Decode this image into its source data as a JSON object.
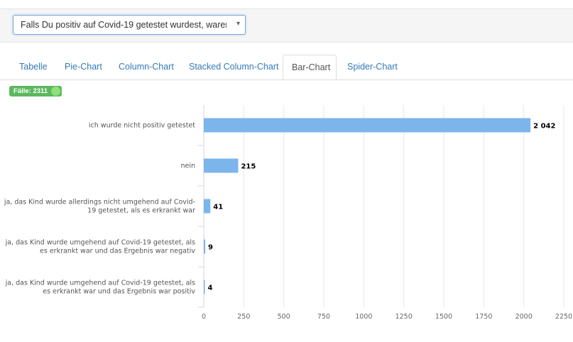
{
  "question_select": {
    "value": "Falls Du positiv auf Covid-19 getestet wurdest, waren…"
  },
  "tabs": [
    {
      "label": "Tabelle"
    },
    {
      "label": "Pie-Chart"
    },
    {
      "label": "Column-Chart"
    },
    {
      "label": "Stacked Column-Chart"
    },
    {
      "label": "Bar-Chart"
    },
    {
      "label": "Spider-Chart"
    }
  ],
  "active_tab": "Bar-Chart",
  "cases_badge": {
    "label": "Fälle: 2311"
  },
  "colors": {
    "bar": "#7cb5ec",
    "badge": "#5cb85c",
    "link": "#337ab7"
  },
  "chart_data": {
    "type": "bar",
    "orientation": "horizontal",
    "categories": [
      [
        "ich wurde nicht positiv getestet"
      ],
      [
        "nein"
      ],
      [
        "ja, das Kind wurde allerdings nicht umgehend auf Covid-",
        "19 getestet, als es erkrankt war"
      ],
      [
        "ja, das Kind wurde umgehend auf Covid-19 getestet, als",
        "es erkrankt war und das Ergebnis war negativ"
      ],
      [
        "ja, das Kind wurde umgehend auf Covid-19 getestet, als",
        "es erkrankt war und das Ergebnis war positiv"
      ]
    ],
    "values": [
      2042,
      215,
      41,
      9,
      4
    ],
    "value_labels": [
      "2 042",
      "215",
      "41",
      "9",
      "4"
    ],
    "xlim": [
      0,
      2250
    ],
    "ticks": [
      0,
      250,
      500,
      750,
      1000,
      1250,
      1500,
      1750,
      2000,
      2250
    ],
    "grid": true,
    "title": "",
    "xlabel": "",
    "ylabel": ""
  }
}
